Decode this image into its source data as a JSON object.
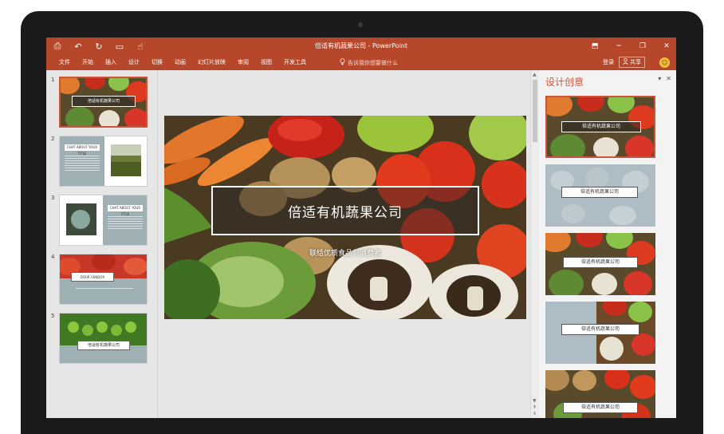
{
  "app": {
    "title": "倍适有机蔬果公司 - PowerPoint"
  },
  "quick_access": [
    {
      "name": "save-icon",
      "glyph": "⎙"
    },
    {
      "name": "undo-icon",
      "glyph": "↶"
    },
    {
      "name": "redo-icon",
      "glyph": "↻"
    },
    {
      "name": "presenter-icon",
      "glyph": "▭"
    },
    {
      "name": "touch-mode-icon",
      "glyph": "☝"
    }
  ],
  "window_controls": {
    "ribbon_options": "⬒",
    "minimize": "─",
    "restore": "❐",
    "close": "✕"
  },
  "ribbon_tabs": [
    "文件",
    "开始",
    "插入",
    "设计",
    "切换",
    "动画",
    "幻灯片放映",
    "审阅",
    "视图",
    "开发工具"
  ],
  "tell_me": "告诉我你想要做什么",
  "account": {
    "login": "登录",
    "share": "共享"
  },
  "thumbnails": {
    "numbers": [
      "1",
      "2",
      "3",
      "4",
      "5"
    ],
    "slide1_title": "倍适有机蔬果公司",
    "slide2_title": "CHAT ABOUT YOUR TITLE",
    "slide3_title": "CHAT ABOUT YOUR TITLE",
    "slide4_title": "DOUR VENDOR",
    "slide5_title": "倍适有机蔬果公司"
  },
  "slide": {
    "title": "倍适有机蔬果公司",
    "subtitle": "联结优质食品与消费者"
  },
  "designer": {
    "title": "设计创意",
    "options": [
      {
        "label": "倍适有机蔬果公司"
      },
      {
        "label": "倍适有机蔬果公司"
      },
      {
        "label": "倍适有机蔬果公司"
      },
      {
        "label": "倍适有机蔬果公司"
      },
      {
        "label": "倍适有机蔬果公司"
      }
    ]
  },
  "colors": {
    "accent": "#b7472a",
    "designer_title": "#c9553a"
  }
}
